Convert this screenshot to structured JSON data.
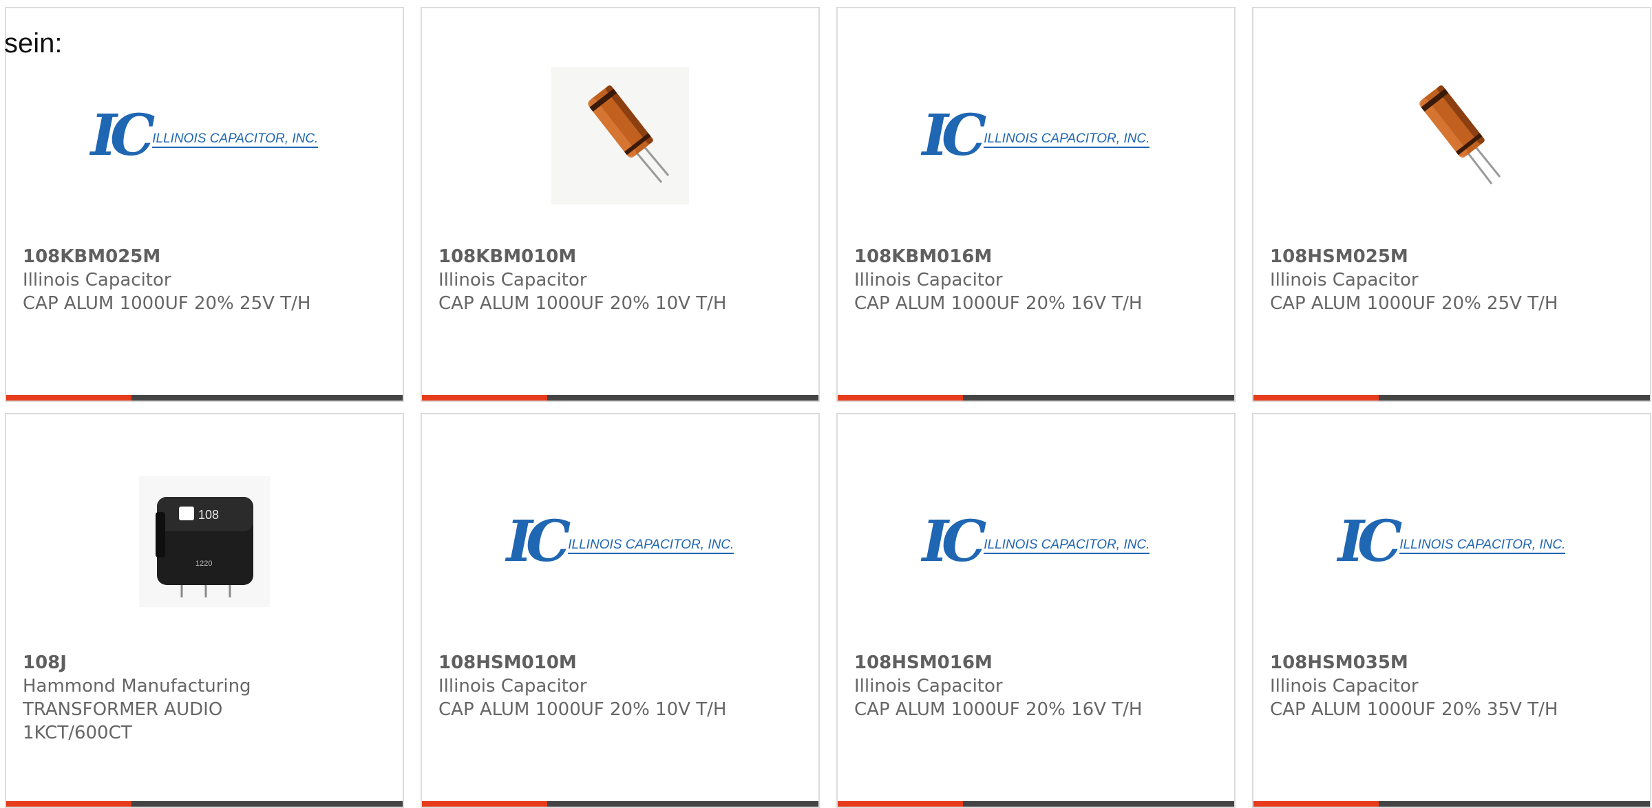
{
  "intro_text": "sein:",
  "accent_color": "#e63c1c",
  "products": [
    {
      "part_number": "108KBM025M",
      "manufacturer": "Illinois Capacitor",
      "description": "CAP ALUM 1000UF 20% 25V T/H",
      "image": "ic-logo",
      "logo_text": "ILLINOIS CAPACITOR, INC."
    },
    {
      "part_number": "108KBM010M",
      "manufacturer": "Illinois Capacitor",
      "description": "CAP ALUM 1000UF 20% 10V T/H",
      "image": "capacitor-photo"
    },
    {
      "part_number": "108KBM016M",
      "manufacturer": "Illinois Capacitor",
      "description": "CAP ALUM 1000UF 20% 16V T/H",
      "image": "ic-logo",
      "logo_text": "ILLINOIS CAPACITOR, INC."
    },
    {
      "part_number": "108HSM025M",
      "manufacturer": "Illinois Capacitor",
      "description": "CAP ALUM 1000UF 20% 25V T/H",
      "image": "capacitor-photo"
    },
    {
      "part_number": "108J",
      "manufacturer": "Hammond Manufacturing",
      "description": "TRANSFORMER AUDIO 1KCT/600CT",
      "image": "transformer-photo",
      "photo_label": "108",
      "photo_code": "1220"
    },
    {
      "part_number": "108HSM010M",
      "manufacturer": "Illinois Capacitor",
      "description": "CAP ALUM 1000UF 20% 10V T/H",
      "image": "ic-logo",
      "logo_text": "ILLINOIS CAPACITOR, INC."
    },
    {
      "part_number": "108HSM016M",
      "manufacturer": "Illinois Capacitor",
      "description": "CAP ALUM 1000UF 20% 16V T/H",
      "image": "ic-logo",
      "logo_text": "ILLINOIS CAPACITOR, INC."
    },
    {
      "part_number": "108HSM035M",
      "manufacturer": "Illinois Capacitor",
      "description": "CAP ALUM 1000UF 20% 35V T/H",
      "image": "ic-logo",
      "logo_text": "ILLINOIS CAPACITOR, INC."
    }
  ]
}
